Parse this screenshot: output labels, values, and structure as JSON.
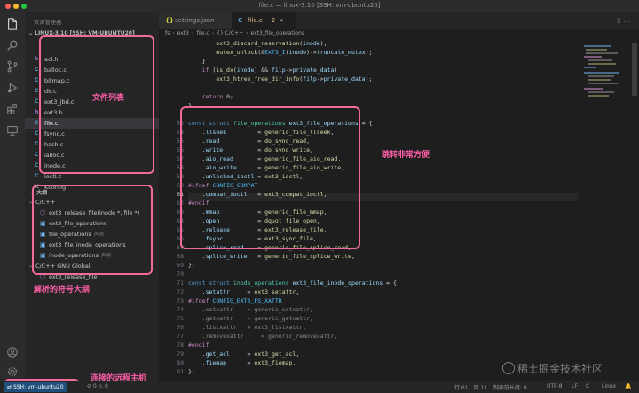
{
  "window": {
    "title": "file.c — linux-3.10 [SSH: vm-ubuntu20]"
  },
  "sidebar": {
    "explorer_title": "资源管理器",
    "project": "LINUX-3.10 [SSH: VM-UBUNTU20]",
    "files": [
      {
        "icon": "h",
        "name": "acl.h"
      },
      {
        "icon": "C",
        "name": "balloc.c"
      },
      {
        "icon": "C",
        "name": "bitmap.c"
      },
      {
        "icon": "C",
        "name": "dir.c"
      },
      {
        "icon": "C",
        "name": "ext3_jbd.c"
      },
      {
        "icon": "h",
        "name": "ext3.h"
      },
      {
        "icon": "C",
        "name": "file.c"
      },
      {
        "icon": "C",
        "name": "fsync.c"
      },
      {
        "icon": "C",
        "name": "hash.c"
      },
      {
        "icon": "C",
        "name": "ialloc.c"
      },
      {
        "icon": "C",
        "name": "inode.c"
      },
      {
        "icon": "C",
        "name": "ioctl.c"
      },
      {
        "icon": "K",
        "name": "Kconfig"
      }
    ],
    "outline_title": "大纲",
    "outline": [
      {
        "kind": "group",
        "label": "C/C++"
      },
      {
        "kind": "fn",
        "label": "ext3_release_file(inode *, file *)",
        "hint": ""
      },
      {
        "kind": "var",
        "label": "ext3_file_operations",
        "hint": ""
      },
      {
        "kind": "var",
        "label": "file_operations",
        "hint": "声明"
      },
      {
        "kind": "var",
        "label": "ext3_file_inode_operations",
        "hint": ""
      },
      {
        "kind": "var",
        "label": "inode_operations",
        "hint": "声明"
      },
      {
        "kind": "group",
        "label": "C/C++ GNU Global"
      },
      {
        "kind": "fn",
        "label": "ext3_release_file",
        "hint": ""
      }
    ]
  },
  "annotations": {
    "file_list": "文件列表",
    "jump_to_definition": "跳转非常方便",
    "symbol_outline": "解析的符号大纲",
    "remote_host": "连接的远程主机"
  },
  "tabs": [
    {
      "icon": "{}",
      "label": "settings.json",
      "modified": ""
    },
    {
      "icon": "C",
      "label": "file.c",
      "modified": "2"
    }
  ],
  "breadcrumb": [
    "fs",
    "ext3",
    "file.c",
    "{} C/C++",
    "ext3_file_operations"
  ],
  "editor": {
    "line_numbers": [
      "",
      "",
      "",
      "",
      "",
      "",
      "",
      "",
      "",
      "53",
      "54",
      "55",
      "56",
      "57",
      "58",
      "59",
      "60",
      "61",
      "62",
      "63",
      "64",
      "65",
      "66",
      "67",
      "68",
      "69",
      "70",
      "71",
      "72",
      "73",
      "74",
      "75",
      "76",
      "77",
      "78",
      "79",
      "80",
      "81"
    ]
  },
  "statusbar": {
    "remote": "SSH: vm-ubuntu20",
    "problems": "⊘ 0 ⚠ 0",
    "position": "行 61，列 11",
    "tab_size": "制表符长度: 8",
    "encoding": "UTF-8",
    "eol": "LF",
    "language": "C",
    "platform": "Linux"
  },
  "watermark": "稀土掘金技术社区",
  "colors": {
    "annotation": "#f06a9b",
    "annotation_text": "#ff5fa8",
    "editor_bg": "#1e1e1e",
    "sidebar_bg": "#252526"
  }
}
